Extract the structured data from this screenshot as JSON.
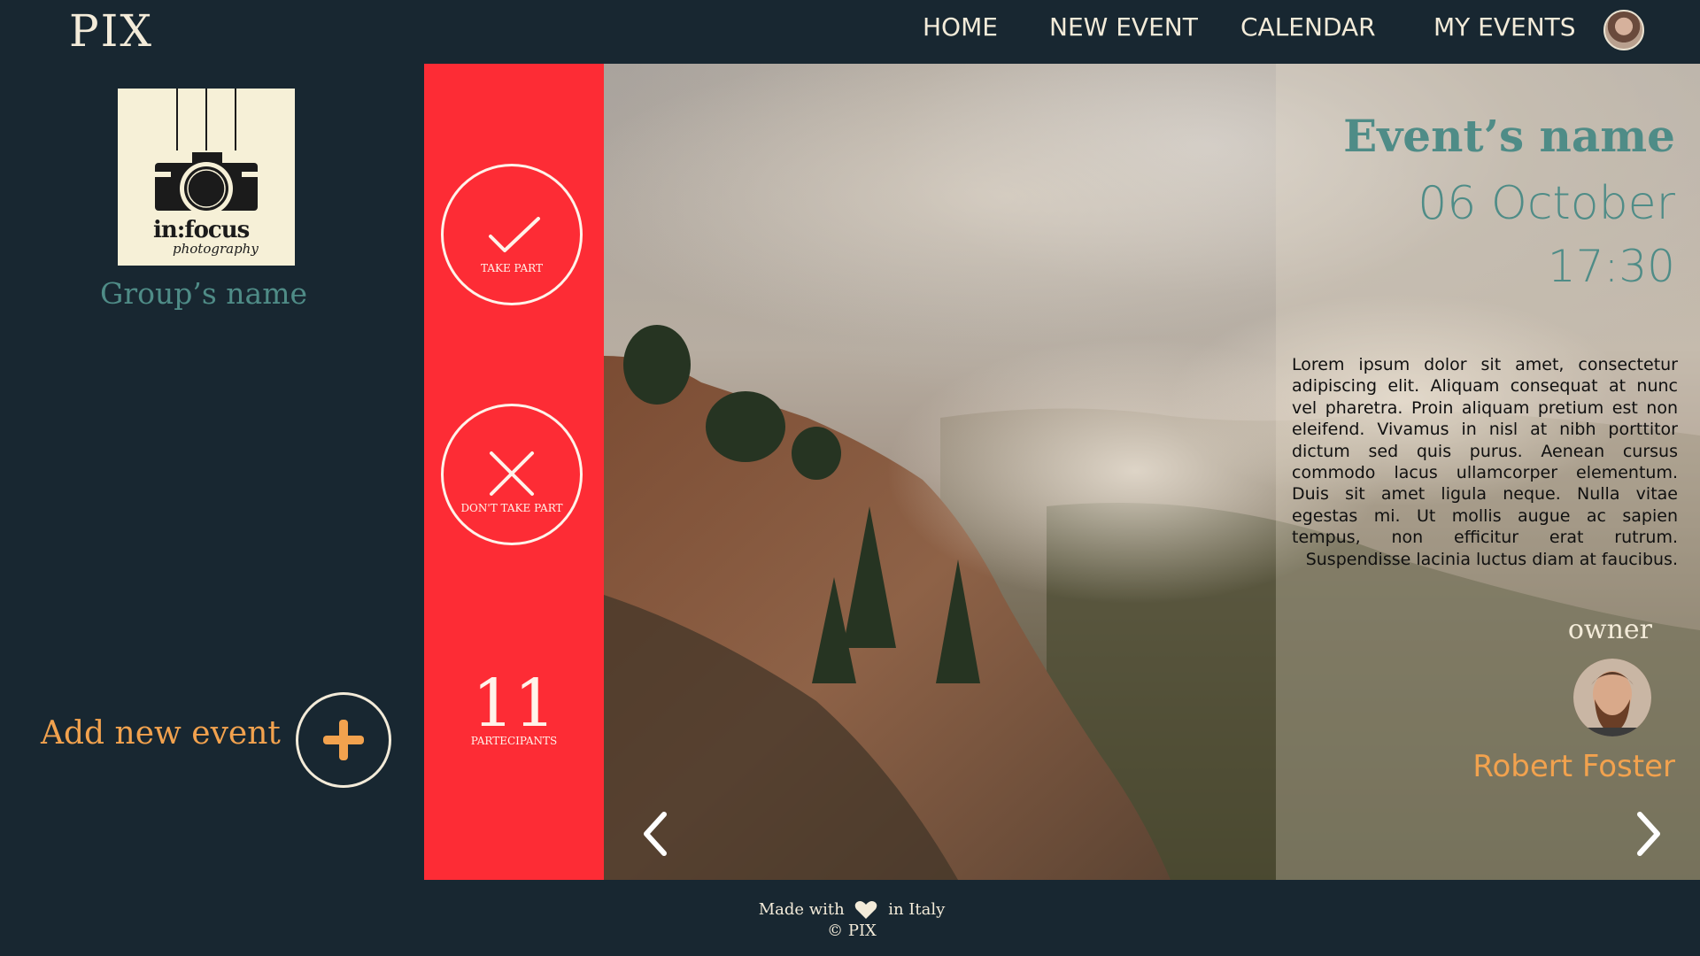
{
  "app": {
    "logo": "PIX"
  },
  "nav": {
    "items": [
      {
        "label": "HOME"
      },
      {
        "label": "NEW EVENT"
      },
      {
        "label": "CALENDAR"
      },
      {
        "label": "MY EVENTS"
      }
    ]
  },
  "sidebar": {
    "group_logo": {
      "brand": "in:focus",
      "tagline": "photography"
    },
    "group_name": "Group’s name",
    "add_event_label": "Add new event"
  },
  "actions": {
    "take_part_label": "TAKE PART",
    "dont_take_part_label": "DON'T TAKE PART",
    "participants_count": "11",
    "participants_label": "PARTECIPANTS"
  },
  "event": {
    "name": "Event’s name",
    "date": "06 October",
    "time": "17:30",
    "description": "Lorem ipsum dolor sit amet, consectetur adipiscing elit. Aliquam consequat at nunc vel pharetra. Proin aliquam pretium est non eleifend. Vivamus in nisl at nibh porttitor dictum sed quis purus. Aenean cursus commodo lacus ullamcorper elementum. Duis sit amet ligula neque. Nulla vitae egestas mi. Ut mollis augue ac sapien tempus, non efficitur erat rutrum. Suspendisse lacinia luctus diam at faucibus.",
    "owner_label": "owner",
    "owner_name": "Robert Foster"
  },
  "footer": {
    "made_with": "Made with",
    "in_italy": "in Italy",
    "copyright": "© PIX"
  },
  "colors": {
    "background": "#182731",
    "accent_red": "#fd2c35",
    "teal": "#4f8c87",
    "orange": "#f2a24e",
    "cream": "#f3ebd9"
  }
}
